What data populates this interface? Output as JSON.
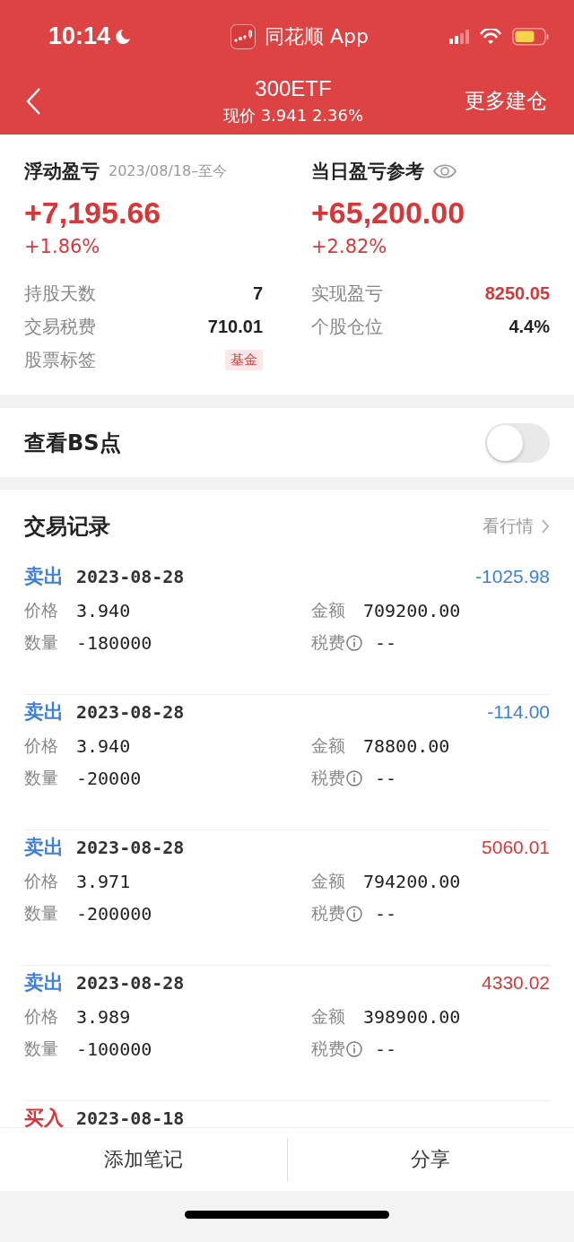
{
  "status_bar": {
    "time": "10:14",
    "app_label": "同花顺 App"
  },
  "header": {
    "title": "300ETF",
    "subtitle": "现价 3.941 2.36%",
    "action": "更多建仓"
  },
  "summary": {
    "floating": {
      "label": "浮动盈亏",
      "period": "2023/08/18–至今",
      "value": "+7,195.66",
      "percent": "+1.86%"
    },
    "daily": {
      "label": "当日盈亏参考",
      "value": "+65,200.00",
      "percent": "+2.82%"
    },
    "left_stats": [
      {
        "kind": "plain",
        "label": "持股天数",
        "value": "7"
      },
      {
        "kind": "plain",
        "label": "交易税费",
        "value": "710.01"
      },
      {
        "kind": "tag",
        "label": "股票标签",
        "value": "基金"
      }
    ],
    "right_stats": [
      {
        "kind": "positive",
        "label": "实现盈亏",
        "value": "8250.05"
      },
      {
        "kind": "plain",
        "label": "个股仓位",
        "value": "4.4%"
      }
    ]
  },
  "bs_toggle": {
    "label": "查看BS点",
    "on": false
  },
  "trades": {
    "title": "交易记录",
    "link": "看行情",
    "records": [
      {
        "kind": "sell",
        "type": "卖出",
        "date": "2023-08-28",
        "result": "-1025.98",
        "color": "#3d7fdb",
        "price_label": "价格",
        "price": "3.940",
        "amount_label": "金额",
        "amount": "709200.00",
        "qty_label": "数量",
        "qty": "-180000",
        "fee_label": "税费",
        "fee": "--"
      },
      {
        "kind": "sell",
        "type": "卖出",
        "date": "2023-08-28",
        "result": "-114.00",
        "color": "#3d7fdb",
        "price_label": "价格",
        "price": "3.940",
        "amount_label": "金额",
        "amount": "78800.00",
        "qty_label": "数量",
        "qty": "-20000",
        "fee_label": "税费",
        "fee": "--"
      },
      {
        "kind": "sell",
        "type": "卖出",
        "date": "2023-08-28",
        "result": "5060.01",
        "color": "#d8373a",
        "price_label": "价格",
        "price": "3.971",
        "amount_label": "金额",
        "amount": "794200.00",
        "qty_label": "数量",
        "qty": "-200000",
        "fee_label": "税费",
        "fee": "--"
      },
      {
        "kind": "sell",
        "type": "卖出",
        "date": "2023-08-28",
        "result": "4330.02",
        "color": "#d8373a",
        "price_label": "价格",
        "price": "3.989",
        "amount_label": "金额",
        "amount": "398900.00",
        "qty_label": "数量",
        "qty": "-100000",
        "fee_label": "税费",
        "fee": "--"
      },
      {
        "kind": "buy",
        "type": "买入",
        "date": "2023-08-18"
      }
    ]
  },
  "footer": {
    "buttons": [
      "添加笔记",
      "分享"
    ]
  }
}
